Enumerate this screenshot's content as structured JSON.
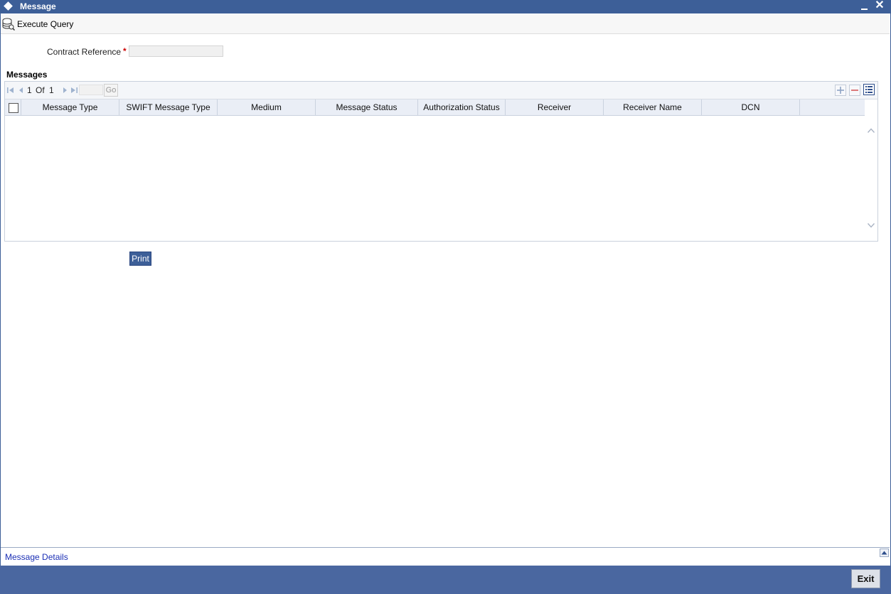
{
  "window": {
    "title": "Message",
    "minimize_icon": "minimize-icon",
    "close_icon": "close-icon"
  },
  "toolbar": {
    "execute_query_label": "Execute Query",
    "execute_query_icon": "database-query-icon"
  },
  "form": {
    "contract_reference_label": "Contract Reference",
    "required_marker": "*",
    "contract_reference_value": ""
  },
  "messages": {
    "section_title": "Messages",
    "pager": {
      "current_page": "1",
      "of_label": "Of",
      "total_pages": "1",
      "page_input_value": "",
      "go_label": "Go"
    },
    "columns": [
      "Message Type",
      "SWIFT Message Type",
      "Medium",
      "Message Status",
      "Authorization Status",
      "Receiver",
      "Receiver Name",
      "DCN"
    ],
    "rows": []
  },
  "actions": {
    "print_label": "Print"
  },
  "details": {
    "message_details_label": "Message Details"
  },
  "footer": {
    "exit_label": "Exit"
  },
  "colors": {
    "titlebar": "#3d5f98",
    "footer": "#4a67a0",
    "link": "#1b2fb5",
    "required": "#cc0000"
  }
}
